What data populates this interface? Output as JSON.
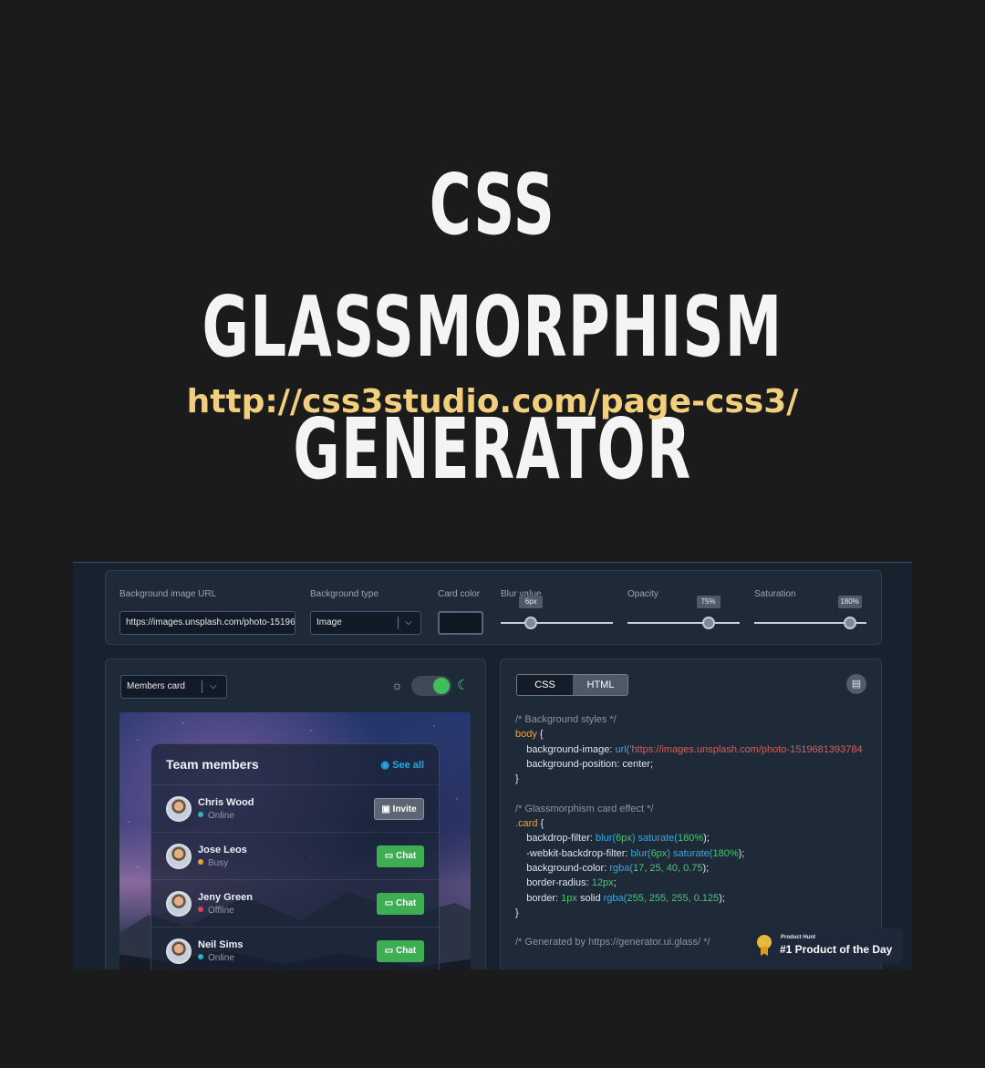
{
  "hero": {
    "title_line1": "CSS GLASSMORPHISM",
    "title_line2": "GENERATOR",
    "url": "http://css3studio.com/page-css3/"
  },
  "controls": {
    "bg_url_label": "Background image URL",
    "bg_url_value": "https://images.unsplash.com/photo-1519681393784",
    "bg_type_label": "Background type",
    "bg_type_value": "Image",
    "card_color_label": "Card color",
    "blur_label": "Blur value",
    "blur_value": "6px",
    "blur_fraction": 0.27,
    "opacity_label": "Opacity",
    "opacity_value": "75%",
    "opacity_fraction": 0.72,
    "saturation_label": "Saturation",
    "saturation_value": "180%",
    "saturation_fraction": 0.85
  },
  "preview_panel": {
    "template_value": "Members card",
    "card": {
      "title": "Team members",
      "see_all": "See all",
      "members": [
        {
          "name": "Chris Wood",
          "status": "Online",
          "status_color": "#2bb3c0",
          "action": "Invite"
        },
        {
          "name": "Jose Leos",
          "status": "Busy",
          "status_color": "#e8a23a",
          "action": "Chat"
        },
        {
          "name": "Jeny Green",
          "status": "Offline",
          "status_color": "#d9435e",
          "action": "Chat"
        },
        {
          "name": "Neil Sims",
          "status": "Online",
          "status_color": "#2bb3c0",
          "action": "Chat"
        }
      ]
    }
  },
  "code_panel": {
    "tab_css": "CSS",
    "tab_html": "HTML",
    "code": {
      "c1": "/* Background styles */",
      "body_sel": "body",
      "open": " {",
      "close": "}",
      "bg_image_prop": "    background-image: ",
      "url_fn": "url(",
      "url_str": "'https://images.unsplash.com/photo-1519681393784",
      "bg_pos": "    background-position: center;",
      "c2": "/* Glassmorphism card effect */",
      "card_sel": ".card",
      "bf_prop": "    backdrop-filter: ",
      "wbf_prop": "    -webkit-backdrop-filter: ",
      "blur_fn": "blur(",
      "blur_num": "6px",
      "sat_fn": "saturate(",
      "sat_num": "180%",
      "paren_close": ")",
      "semi": ");",
      "bgc_prop": "    background-color: ",
      "rgba_fn": "rgba(",
      "rgba_vals": "17, 25, 40, 0.75",
      "radius_prop": "    border-radius: ",
      "radius_val": "12px",
      "border_prop": "    border: ",
      "border_width": "1px",
      "border_solid": " solid ",
      "border_rgba": "255, 255, 255, 0.125",
      "c3": "/* Generated by https://generator.ui.glass/ */"
    }
  },
  "badge": {
    "small": "Product Hunt",
    "big": "#1 Product of the Day"
  }
}
